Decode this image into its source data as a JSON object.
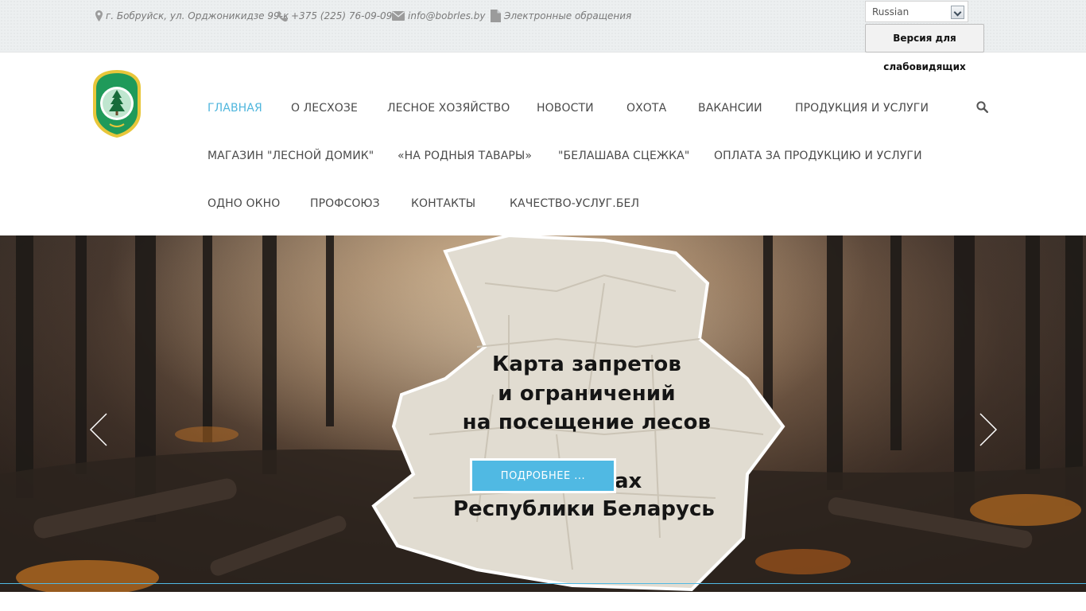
{
  "topbar": {
    "address": "г. Бобруйск, ул. Орджоникидзе 99-к",
    "phone": "+375 (225) 76-09-09",
    "email": "info@bobrles.by",
    "appeals": "Электронные обращения",
    "language_selected": "Russian",
    "accessibility_line1": "Версия для",
    "accessibility_line2": "слабовидящих"
  },
  "nav": {
    "items": [
      "ГЛАВНАЯ",
      "О ЛЕСХОЗЕ",
      "ЛЕСНОЕ ХОЗЯЙСТВО",
      "НОВОСТИ",
      "ОХОТА",
      "ВАКАНСИИ",
      "ПРОДУКЦИЯ И УСЛУГИ",
      "МАГАЗИН \"ЛЕСНОЙ ДОМИК\"",
      "«НА РОДНЫЯ ТАВАРЫ»",
      "\"БЕЛАШАВА СЦЕЖКА\"",
      "ОПЛАТА ЗА ПРОДУКЦИЮ И УСЛУГИ",
      "ОДНО ОКНО",
      "ПРОФСОЮЗ",
      "КОНТАКТЫ",
      "КАЧЕСТВО-УСЛУГ.БЕЛ"
    ],
    "active_index": 0
  },
  "slide": {
    "title_line1": "Карта запретов",
    "title_line2": "и ограничений",
    "title_line3": "на посещение лесов",
    "title_tail1": "ах",
    "title_tail2": "Республики Беларусь",
    "button_label": "ПОДРОБНЕЕ ..."
  },
  "colors": {
    "accent": "#4fb6dd",
    "button": "#50b9e3",
    "nav_text": "#4a4a4a"
  }
}
